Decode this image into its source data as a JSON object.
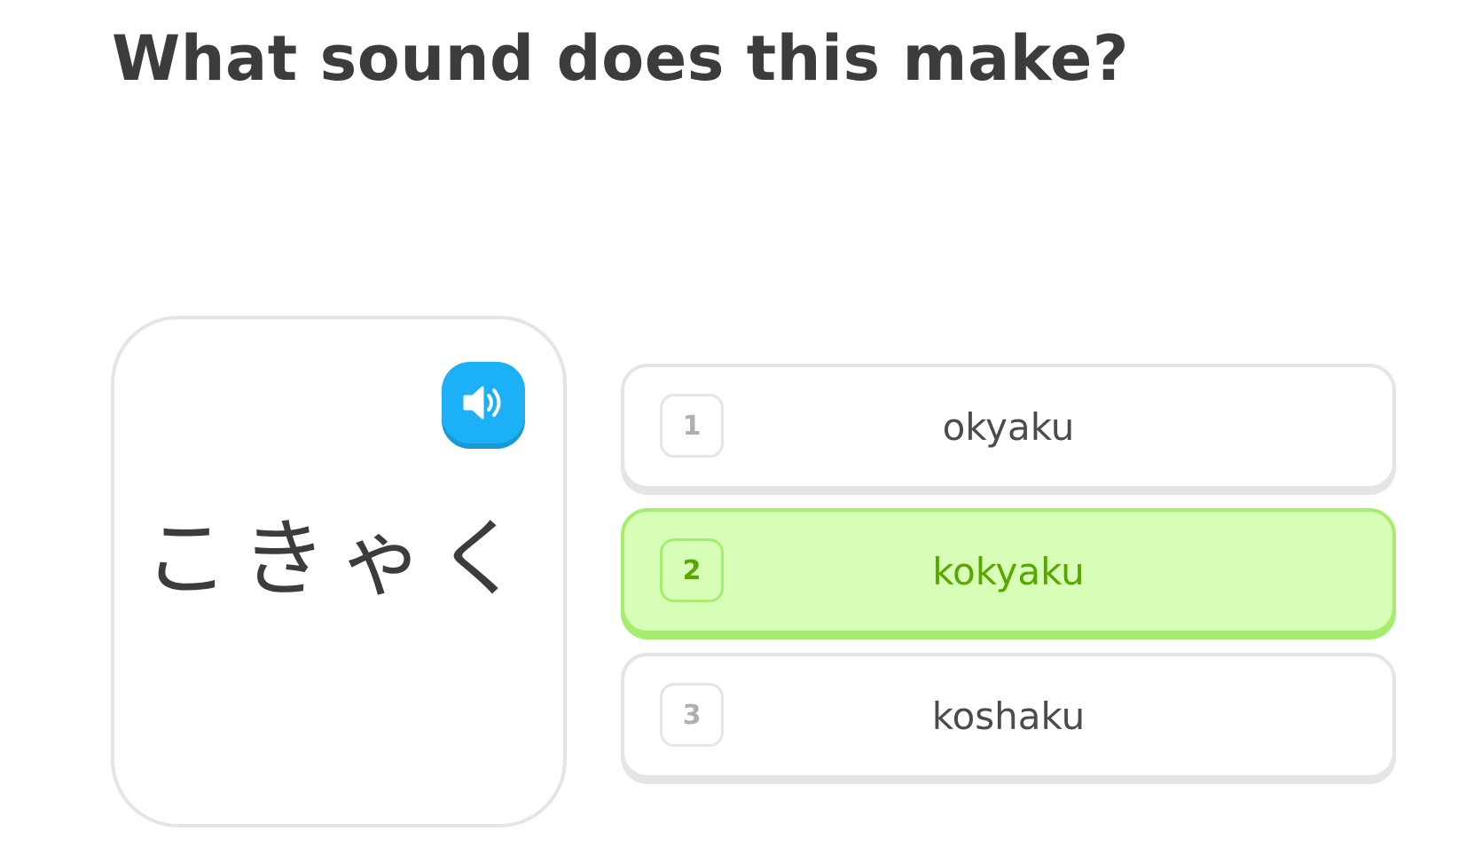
{
  "prompt": {
    "title": "What sound does this make?"
  },
  "card": {
    "kana": "こきゃく",
    "audio_icon": "speaker-icon",
    "accent_color": "#1cb0f6"
  },
  "options": [
    {
      "number": "1",
      "label": "okyaku",
      "selected": false
    },
    {
      "number": "2",
      "label": "kokyaku",
      "selected": true
    },
    {
      "number": "3",
      "label": "koshaku",
      "selected": false
    }
  ],
  "colors": {
    "selected_background": "#d7ffb8",
    "selected_border": "#a5ed6e",
    "selected_text": "#58a700",
    "default_border": "#e5e5e5",
    "text": "#3c3c3c"
  }
}
